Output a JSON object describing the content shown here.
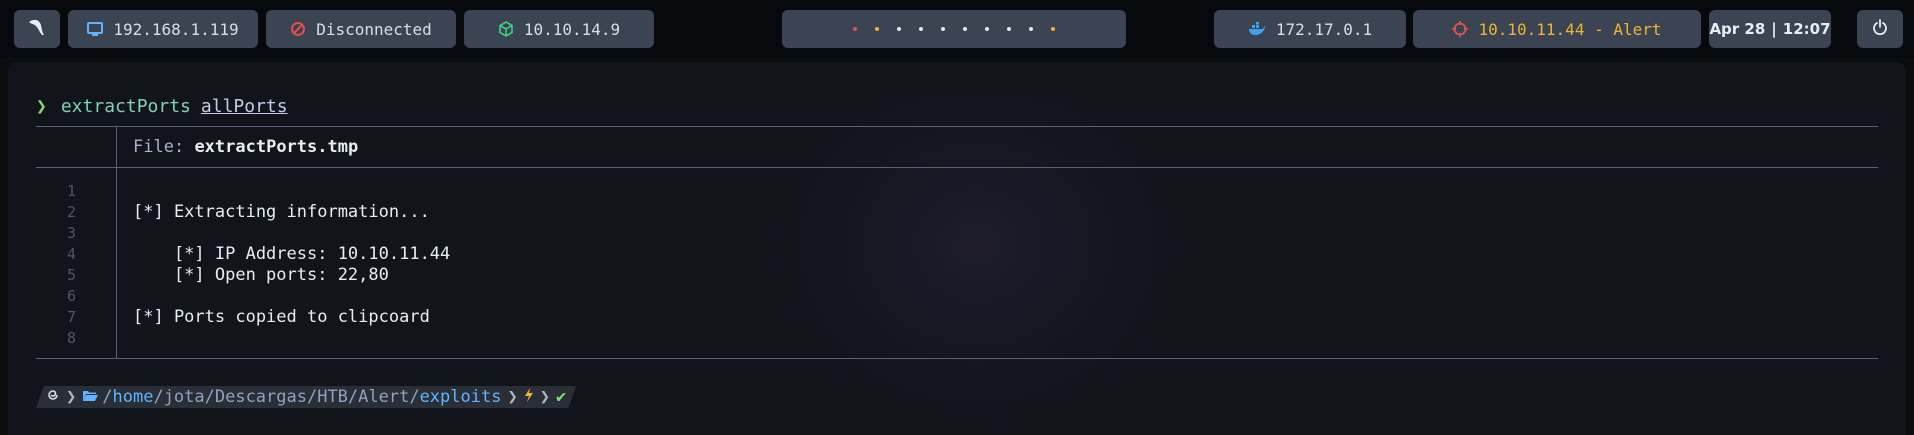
{
  "topbar": {
    "menu_icon": "kali-dragon-icon",
    "local_ip": "192.168.1.119",
    "vpn_status": "Disconnected",
    "vpn_ip": "10.10.14.9",
    "workspaces": {
      "indicator_colors": [
        "#e05050",
        "#f2b233",
        "#e6e6e6",
        "#e6e6e6",
        "#e6e6e6",
        "#e6e6e6",
        "#e6e6e6",
        "#e6e6e6",
        "#e6e6e6",
        "#f2b233"
      ]
    },
    "docker_ip": "172.17.0.1",
    "target": "10.10.11.44 - Alert",
    "date": "Apr 28",
    "time": "12:07",
    "power_icon": "power-icon"
  },
  "terminal": {
    "command": "extractPorts",
    "argument": "allPorts",
    "file_label": "File:",
    "file_name": "extractPorts.tmp",
    "lines": [
      {
        "n": "1",
        "text": ""
      },
      {
        "n": "2",
        "text": "[*] Extracting information..."
      },
      {
        "n": "3",
        "text": ""
      },
      {
        "n": "4",
        "text": "    [*] IP Address: 10.10.11.44"
      },
      {
        "n": "5",
        "text": "    [*] Open ports: 22,80"
      },
      {
        "n": "6",
        "text": ""
      },
      {
        "n": "7",
        "text": "[*] Ports copied to clipcoard"
      },
      {
        "n": "8",
        "text": ""
      }
    ],
    "prompt": {
      "path_root": "/",
      "path_home": "home",
      "path_mid": "/jota/Descargas/HTB/Alert/",
      "path_last": "exploits",
      "status_icon": "check-icon"
    }
  },
  "colors": {
    "pill_bg": "#3a4452",
    "alert": "#f2b233",
    "prompt_green": "#7ee06e"
  }
}
